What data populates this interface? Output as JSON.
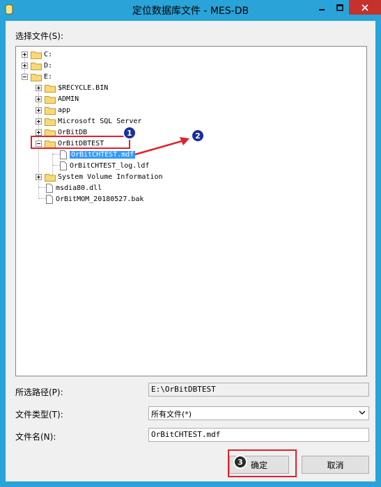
{
  "window": {
    "title": "定位数据库文件 - MES-DB"
  },
  "labels": {
    "select_file": "选择文件(S):",
    "selected_path": "所选路径(P):",
    "file_type": "文件类型(T):",
    "file_name": "文件名(N):"
  },
  "tree": [
    {
      "label": "C:"
    },
    {
      "label": "D:"
    },
    {
      "label": "E:"
    },
    {
      "label": "$RECYCLE.BIN"
    },
    {
      "label": "ADMIN"
    },
    {
      "label": "app"
    },
    {
      "label": "Microsoft SQL Server"
    },
    {
      "label": "OrBitDB"
    },
    {
      "label": "OrBitDBTEST"
    },
    {
      "label": "OrBitCHTEST.mdf"
    },
    {
      "label": "OrBitCHTEST_log.ldf"
    },
    {
      "label": "System Volume Information"
    },
    {
      "label": "msdia80.dll"
    },
    {
      "label": "OrBitMOM_20180527.bak"
    }
  ],
  "fields": {
    "selected_path": "E:\\OrBitDBTEST",
    "file_type": "所有文件(*)",
    "file_name": "OrBitCHTEST.mdf"
  },
  "buttons": {
    "ok": "确定",
    "cancel": "取消"
  },
  "annotations": {
    "badge1": "1",
    "badge2": "2",
    "badge3": "3"
  },
  "colors": {
    "title_bar": "#29a3d8",
    "close_button": "#c7312b",
    "selection": "#3399ff",
    "annotation": "#e0202a"
  }
}
